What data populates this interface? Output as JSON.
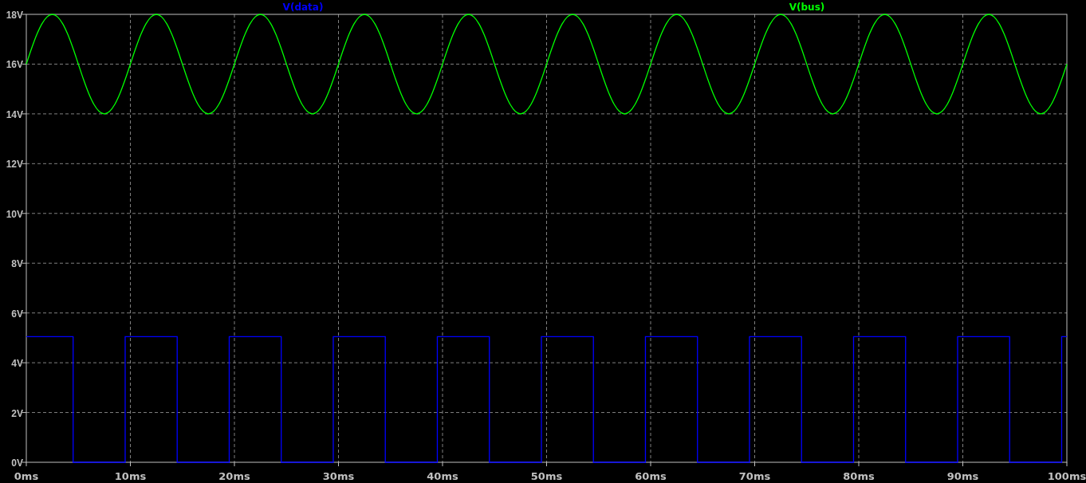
{
  "plot": {
    "chart_data": {
      "type": "line",
      "grid": true,
      "xlim": [
        0,
        100
      ],
      "ylim": [
        0,
        18
      ],
      "xticks": [
        {
          "value": 0,
          "label": "0ms"
        },
        {
          "value": 10,
          "label": "10ms"
        },
        {
          "value": 20,
          "label": "20ms"
        },
        {
          "value": 30,
          "label": "30ms"
        },
        {
          "value": 40,
          "label": "40ms"
        },
        {
          "value": 50,
          "label": "50ms"
        },
        {
          "value": 60,
          "label": "60ms"
        },
        {
          "value": 70,
          "label": "70ms"
        },
        {
          "value": 80,
          "label": "80ms"
        },
        {
          "value": 90,
          "label": "90ms"
        },
        {
          "value": 100,
          "label": "100ms"
        }
      ],
      "yticks": [
        {
          "value": 0,
          "label": "0V"
        },
        {
          "value": 2,
          "label": "2V"
        },
        {
          "value": 4,
          "label": "4V"
        },
        {
          "value": 6,
          "label": "6V"
        },
        {
          "value": 8,
          "label": "8V"
        },
        {
          "value": 10,
          "label": "10V"
        },
        {
          "value": 12,
          "label": "12V"
        },
        {
          "value": 14,
          "label": "14V"
        },
        {
          "value": 16,
          "label": "16V"
        },
        {
          "value": 18,
          "label": "18V"
        }
      ],
      "x": [
        0,
        0.5,
        1,
        1.5,
        2,
        2.5,
        3,
        3.5,
        4,
        4.5,
        4.5,
        5,
        5.5,
        6,
        6.5,
        7,
        7.5,
        8,
        8.5,
        9,
        9.5,
        9.5,
        10,
        10.5,
        11,
        11.5,
        12,
        12.5,
        13,
        13.5,
        14,
        14.5,
        14.5,
        15,
        15.5,
        16,
        16.5,
        17,
        17.5,
        18,
        18.5,
        19,
        19.5,
        19.5,
        20,
        20.5,
        21,
        21.5,
        22,
        22.5,
        23,
        23.5,
        24,
        24.5,
        24.5,
        25,
        25.5,
        26,
        26.5,
        27,
        27.5,
        28,
        28.5,
        29,
        29.5,
        29.5,
        30,
        30.5,
        31,
        31.5,
        32,
        32.5,
        33,
        33.5,
        34,
        34.5,
        34.5,
        35,
        35.5,
        36,
        36.5,
        37,
        37.5,
        38,
        38.5,
        39,
        39.5,
        39.5,
        40,
        40.5,
        41,
        41.5,
        42,
        42.5,
        43,
        43.5,
        44,
        44.5,
        44.5,
        45,
        45.5,
        46,
        46.5,
        47,
        47.5,
        48,
        48.5,
        49,
        49.5,
        49.5,
        50,
        50.5,
        51,
        51.5,
        52,
        52.5,
        53,
        53.5,
        54,
        54.5,
        54.5,
        55,
        55.5,
        56,
        56.5,
        57,
        57.5,
        58,
        58.5,
        59,
        59.5,
        59.5,
        60,
        60.5,
        61,
        61.5,
        62,
        62.5,
        63,
        63.5,
        64,
        64.5,
        64.5,
        65,
        65.5,
        66,
        66.5,
        67,
        67.5,
        68,
        68.5,
        69,
        69.5,
        69.5,
        70,
        70.5,
        71,
        71.5,
        72,
        72.5,
        73,
        73.5,
        74,
        74.5,
        74.5,
        75,
        75.5,
        76,
        76.5,
        77,
        77.5,
        78,
        78.5,
        79,
        79.5,
        79.5,
        80,
        80.5,
        81,
        81.5,
        82,
        82.5,
        83,
        83.5,
        84,
        84.5,
        84.5,
        85,
        85.5,
        86,
        86.5,
        87,
        87.5,
        88,
        88.5,
        89,
        89.5,
        89.5,
        90,
        90.5,
        91,
        91.5,
        92,
        92.5,
        93,
        93.5,
        94,
        94.5,
        94.5,
        95,
        95.5,
        96,
        96.5,
        97,
        97.5,
        98,
        98.5,
        99,
        99.5,
        99.5,
        100
      ],
      "series": [
        {
          "name": "V(data)",
          "color": "#0000ff",
          "values": [
            5.05,
            5.05,
            5.05,
            5.05,
            5.05,
            5.05,
            5.05,
            5.05,
            5.05,
            5.05,
            0,
            0,
            0,
            0,
            0,
            0,
            0,
            0,
            0,
            0,
            0,
            5.05,
            5.05,
            5.05,
            5.05,
            5.05,
            5.05,
            5.05,
            5.05,
            5.05,
            5.05,
            5.05,
            0,
            0,
            0,
            0,
            0,
            0,
            0,
            0,
            0,
            0,
            0,
            5.05,
            5.05,
            5.05,
            5.05,
            5.05,
            5.05,
            5.05,
            5.05,
            5.05,
            5.05,
            5.05,
            0,
            0,
            0,
            0,
            0,
            0,
            0,
            0,
            0,
            0,
            0,
            5.05,
            5.05,
            5.05,
            5.05,
            5.05,
            5.05,
            5.05,
            5.05,
            5.05,
            5.05,
            5.05,
            0,
            0,
            0,
            0,
            0,
            0,
            0,
            0,
            0,
            0,
            0,
            5.05,
            5.05,
            5.05,
            5.05,
            5.05,
            5.05,
            5.05,
            5.05,
            5.05,
            5.05,
            5.05,
            0,
            0,
            0,
            0,
            0,
            0,
            0,
            0,
            0,
            0,
            0,
            5.05,
            5.05,
            5.05,
            5.05,
            5.05,
            5.05,
            5.05,
            5.05,
            5.05,
            5.05,
            5.05,
            0,
            0,
            0,
            0,
            0,
            0,
            0,
            0,
            0,
            0,
            0,
            5.05,
            5.05,
            5.05,
            5.05,
            5.05,
            5.05,
            5.05,
            5.05,
            5.05,
            5.05,
            5.05,
            0,
            0,
            0,
            0,
            0,
            0,
            0,
            0,
            0,
            0,
            0,
            5.05,
            5.05,
            5.05,
            5.05,
            5.05,
            5.05,
            5.05,
            5.05,
            5.05,
            5.05,
            5.05,
            0,
            0,
            0,
            0,
            0,
            0,
            0,
            0,
            0,
            0,
            0,
            5.05,
            5.05,
            5.05,
            5.05,
            5.05,
            5.05,
            5.05,
            5.05,
            5.05,
            5.05,
            5.05,
            0,
            0,
            0,
            0,
            0,
            0,
            0,
            0,
            0,
            0,
            0,
            5.05,
            5.05,
            5.05,
            5.05,
            5.05,
            5.05,
            5.05,
            5.05,
            5.05,
            5.05,
            5.05,
            0,
            0,
            0,
            0,
            0,
            0,
            0,
            0,
            0,
            0,
            0,
            5.05,
            5.05
          ]
        },
        {
          "name": "V(bus)",
          "color": "#00ff00",
          "values": [
            16,
            16.62,
            17.18,
            17.62,
            17.9,
            18,
            17.9,
            17.62,
            17.18,
            16.62,
            16.62,
            16,
            15.38,
            14.82,
            14.38,
            14.1,
            14,
            14.1,
            14.38,
            14.82,
            15.38,
            15.38,
            16,
            16.62,
            17.18,
            17.62,
            17.9,
            18,
            17.9,
            17.62,
            17.18,
            16.62,
            16.62,
            16,
            15.38,
            14.82,
            14.38,
            14.1,
            14,
            14.1,
            14.38,
            14.82,
            15.38,
            15.38,
            16,
            16.62,
            17.18,
            17.62,
            17.9,
            18,
            17.9,
            17.62,
            17.18,
            16.62,
            16.62,
            16,
            15.38,
            14.82,
            14.38,
            14.1,
            14,
            14.1,
            14.38,
            14.82,
            15.38,
            15.38,
            16,
            16.62,
            17.18,
            17.62,
            17.9,
            18,
            17.9,
            17.62,
            17.18,
            16.62,
            16.62,
            16,
            15.38,
            14.82,
            14.38,
            14.1,
            14,
            14.1,
            14.38,
            14.82,
            15.38,
            15.38,
            16,
            16.62,
            17.18,
            17.62,
            17.9,
            18,
            17.9,
            17.62,
            17.18,
            16.62,
            16.62,
            16,
            15.38,
            14.82,
            14.38,
            14.1,
            14,
            14.1,
            14.38,
            14.82,
            15.38,
            15.38,
            16,
            16.62,
            17.18,
            17.62,
            17.9,
            18,
            17.9,
            17.62,
            17.18,
            16.62,
            16.62,
            16,
            15.38,
            14.82,
            14.38,
            14.1,
            14,
            14.1,
            14.38,
            14.82,
            15.38,
            15.38,
            16,
            16.62,
            17.18,
            17.62,
            17.9,
            18,
            17.9,
            17.62,
            17.18,
            16.62,
            16.62,
            16,
            15.38,
            14.82,
            14.38,
            14.1,
            14,
            14.1,
            14.38,
            14.82,
            15.38,
            15.38,
            16,
            16.62,
            17.18,
            17.62,
            17.9,
            18,
            17.9,
            17.62,
            17.18,
            16.62,
            16.62,
            16,
            15.38,
            14.82,
            14.38,
            14.1,
            14,
            14.1,
            14.38,
            14.82,
            15.38,
            15.38,
            16,
            16.62,
            17.18,
            17.62,
            17.9,
            18,
            17.9,
            17.62,
            17.18,
            16.62,
            16.62,
            16,
            15.38,
            14.82,
            14.38,
            14.1,
            14,
            14.1,
            14.38,
            14.82,
            15.38,
            15.38,
            16,
            16.62,
            17.18,
            17.62,
            17.9,
            18,
            17.9,
            17.62,
            17.18,
            16.62,
            16.62,
            16,
            15.38,
            14.82,
            14.38,
            14.1,
            14,
            14.1,
            14.38,
            14.82,
            15.38,
            15.38,
            16
          ]
        }
      ]
    }
  }
}
